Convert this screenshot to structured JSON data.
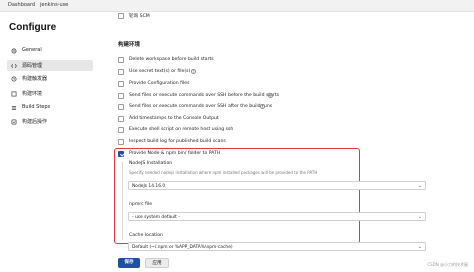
{
  "breadcrumb": {
    "dashboard": "Dashboard",
    "job": "jenkins-use"
  },
  "page_title": "Configure",
  "sidebar": {
    "items": [
      {
        "label": "General",
        "icon": "gear-icon",
        "active": false
      },
      {
        "label": "源码管理",
        "icon": "source-code-icon",
        "active": true
      },
      {
        "label": "构建触发器",
        "icon": "trigger-icon",
        "active": false
      },
      {
        "label": "构建环境",
        "icon": "environment-icon",
        "active": false
      },
      {
        "label": "Build Steps",
        "icon": "build-steps-icon",
        "active": false
      },
      {
        "label": "构建后操作",
        "icon": "post-build-icon",
        "active": false
      }
    ]
  },
  "top_option": "轮询 SCM",
  "section_title": "构建环境",
  "build_env_options": [
    {
      "label": "Delete workspace before build starts",
      "checked": false
    },
    {
      "label": "Use secret text(s) or file(s)",
      "checked": false
    },
    {
      "label": "Provide Configuration files",
      "checked": false
    },
    {
      "label": "Send files or execute commands over SSH before the build starts",
      "checked": false
    },
    {
      "label": "Send files or execute commands over SSH after the build runs",
      "checked": false
    },
    {
      "label": "Add timestamps to the Console Output",
      "checked": false
    },
    {
      "label": "Execute shell script on remote host using ssh",
      "checked": false
    },
    {
      "label": "Inspect build log for published build scans",
      "checked": false
    }
  ],
  "node_option": {
    "label": "Provide Node & npm bin/ folder to PATH",
    "checked": true,
    "nodejs_installation_label": "NodeJS Installation",
    "nodejs_help": "Specify needed nodejs installation where npm installed packages will be provided to the PATH",
    "nodejs_value": "NodeJs 14.16.0",
    "npmrc_label": "npmrc file",
    "npmrc_value": "- use system default -",
    "cache_label": "Cache location",
    "cache_value": "Default (~/.npm or %APP_DATA%\\npm-cache)"
  },
  "buttons": {
    "save": "保存",
    "apply": "应用"
  },
  "watermark": "CSDN @小刀的技术屋",
  "colors": {
    "accent": "#1f4ea3",
    "highlight_box": "#e53935"
  }
}
